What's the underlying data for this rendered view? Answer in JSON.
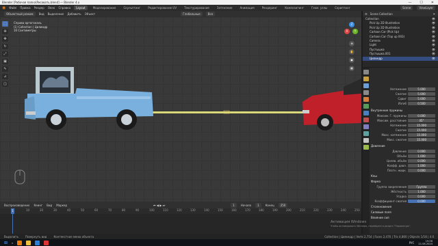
{
  "titlebar": {
    "title": "Blender [Рабочая папка\\Рисовать.blend] — Blender 4.x",
    "minimize": "—",
    "maximize": "☐",
    "close": "✕"
  },
  "menubar": {
    "app_icon": "blender-logo",
    "menus": [
      "Файл",
      "Правка",
      "Рендер",
      "Окно",
      "Справка"
    ],
    "workspaces": [
      "Layout",
      "Моделирование",
      "Скульптинг",
      "Редактирование UV",
      "Текстурирование",
      "Затенение",
      "Анимация",
      "Рендеринг",
      "Композитинг",
      "Геом. узлы",
      "Скриптинг"
    ],
    "active_workspace": "Layout",
    "scene": "Scene",
    "view_layer": "ViewLayer"
  },
  "vpheader": {
    "mode": "Объектный режим",
    "items": [
      "Вид",
      "Выделение",
      "Добавить",
      "Объект"
    ],
    "orientation": "Глобальные",
    "snap": "Все"
  },
  "viewinfo": {
    "line1": "Справа ортогональ",
    "line2": "(1) Collection | Цилиндр",
    "line3": "10 Сантиметры"
  },
  "gizmo": {
    "x": "X",
    "y": "Y",
    "z": "Z"
  },
  "timeline": {
    "menus": [
      "Воспроизведение",
      "Кеинг",
      "Вид",
      "Маркер"
    ],
    "current_frame": "1",
    "start": "1",
    "end": "250",
    "start_label": "Начало",
    "end_label": "Конец",
    "ticks": [
      "1",
      "10",
      "20",
      "30",
      "40",
      "50",
      "60",
      "70",
      "80",
      "90",
      "100",
      "110",
      "120",
      "130",
      "140",
      "150",
      "160",
      "170",
      "180",
      "190",
      "200",
      "210",
      "220",
      "230",
      "240",
      "250"
    ]
  },
  "statusbar": {
    "select": "Выделить",
    "pan": "Повернуть вид",
    "menu": "Контекстное меню объекта",
    "stats": "Collection | Цилиндр | Verts 2,754 | Faces 2,476 | Tris 4,860 | Objects 1/18 | 4.0"
  },
  "taskbar": {
    "time": "19:56",
    "date": "21.08.2024",
    "lang": "РУС"
  },
  "outliner": {
    "title": "Scene Collection",
    "rows": [
      {
        "label": "Collection",
        "sel": false
      },
      {
        "label": "Pick Up 2D Illustration",
        "sel": false
      },
      {
        "label": "Pick Up 2D Illustration",
        "sel": false
      },
      {
        "label": "Cartoon Car (Pick Up)",
        "sel": false
      },
      {
        "label": "Cartoon Car (Тор up 003)",
        "sel": false
      },
      {
        "label": "Camera",
        "sel": false
      },
      {
        "label": "Light",
        "sel": false
      },
      {
        "label": "Пустышка",
        "sel": false
      },
      {
        "label": "Пустышка.001",
        "sel": false
      },
      {
        "label": "Цилиндр",
        "sel": true
      }
    ]
  },
  "properties": {
    "rows": [
      {
        "label": "Натяжение",
        "value": "5.000"
      },
      {
        "label": "Сжатие",
        "value": "5.000"
      },
      {
        "label": "Сдвиг",
        "value": "5.000"
      },
      {
        "label": "Изгиб",
        "value": "0.500"
      }
    ],
    "sec_internal": "Внутренние пружины",
    "internal_rows": [
      {
        "label": "Максим. Г. пружины",
        "value": "0.000"
      },
      {
        "label": "Максим. расстояние",
        "value": "45°"
      },
      {
        "label": "Натяжение",
        "value": "15.000"
      },
      {
        "label": "Сжатие",
        "value": "15.000"
      },
      {
        "label": "Макс. натяжения",
        "value": "15.000"
      },
      {
        "label": "Макс. сжатия",
        "value": "15.000"
      }
    ],
    "sec_pressure": "Давление",
    "pressure_rows": [
      {
        "label": "Давление",
        "value": "0.000"
      },
      {
        "label": "Объём",
        "value": "1.000"
      },
      {
        "label": "Целев. объём",
        "value": "0.000"
      },
      {
        "label": "Коэфф. давл.",
        "value": "1.000"
      },
      {
        "label": "Плотн. жидк.",
        "value": "0.000"
      }
    ],
    "sec_cache": "Кеш",
    "sec_shape": "Форма",
    "shape_rows": [
      {
        "label": "Группа закрепления",
        "value": "Группа"
      },
      {
        "label": "Жёсткость",
        "value": "1.000"
      },
      {
        "label": "Усадка",
        "value": "0.000"
      },
      {
        "label": "Коэффициент сжатия",
        "value": "0.000"
      }
    ],
    "sec_collisions": "Столкновения",
    "sec_fields": "Силовые поля",
    "sec_weights": "Влияние сил"
  },
  "watermark": {
    "line1": "Активация Windows",
    "line2": "Чтобы активировать Windows, перейдите в раздел \"Параметры\"."
  },
  "colors": {
    "accent": "#4772b3",
    "truck_body": "#7ab0dd",
    "red_car": "#c0202a",
    "rope": "#d9d97a"
  }
}
